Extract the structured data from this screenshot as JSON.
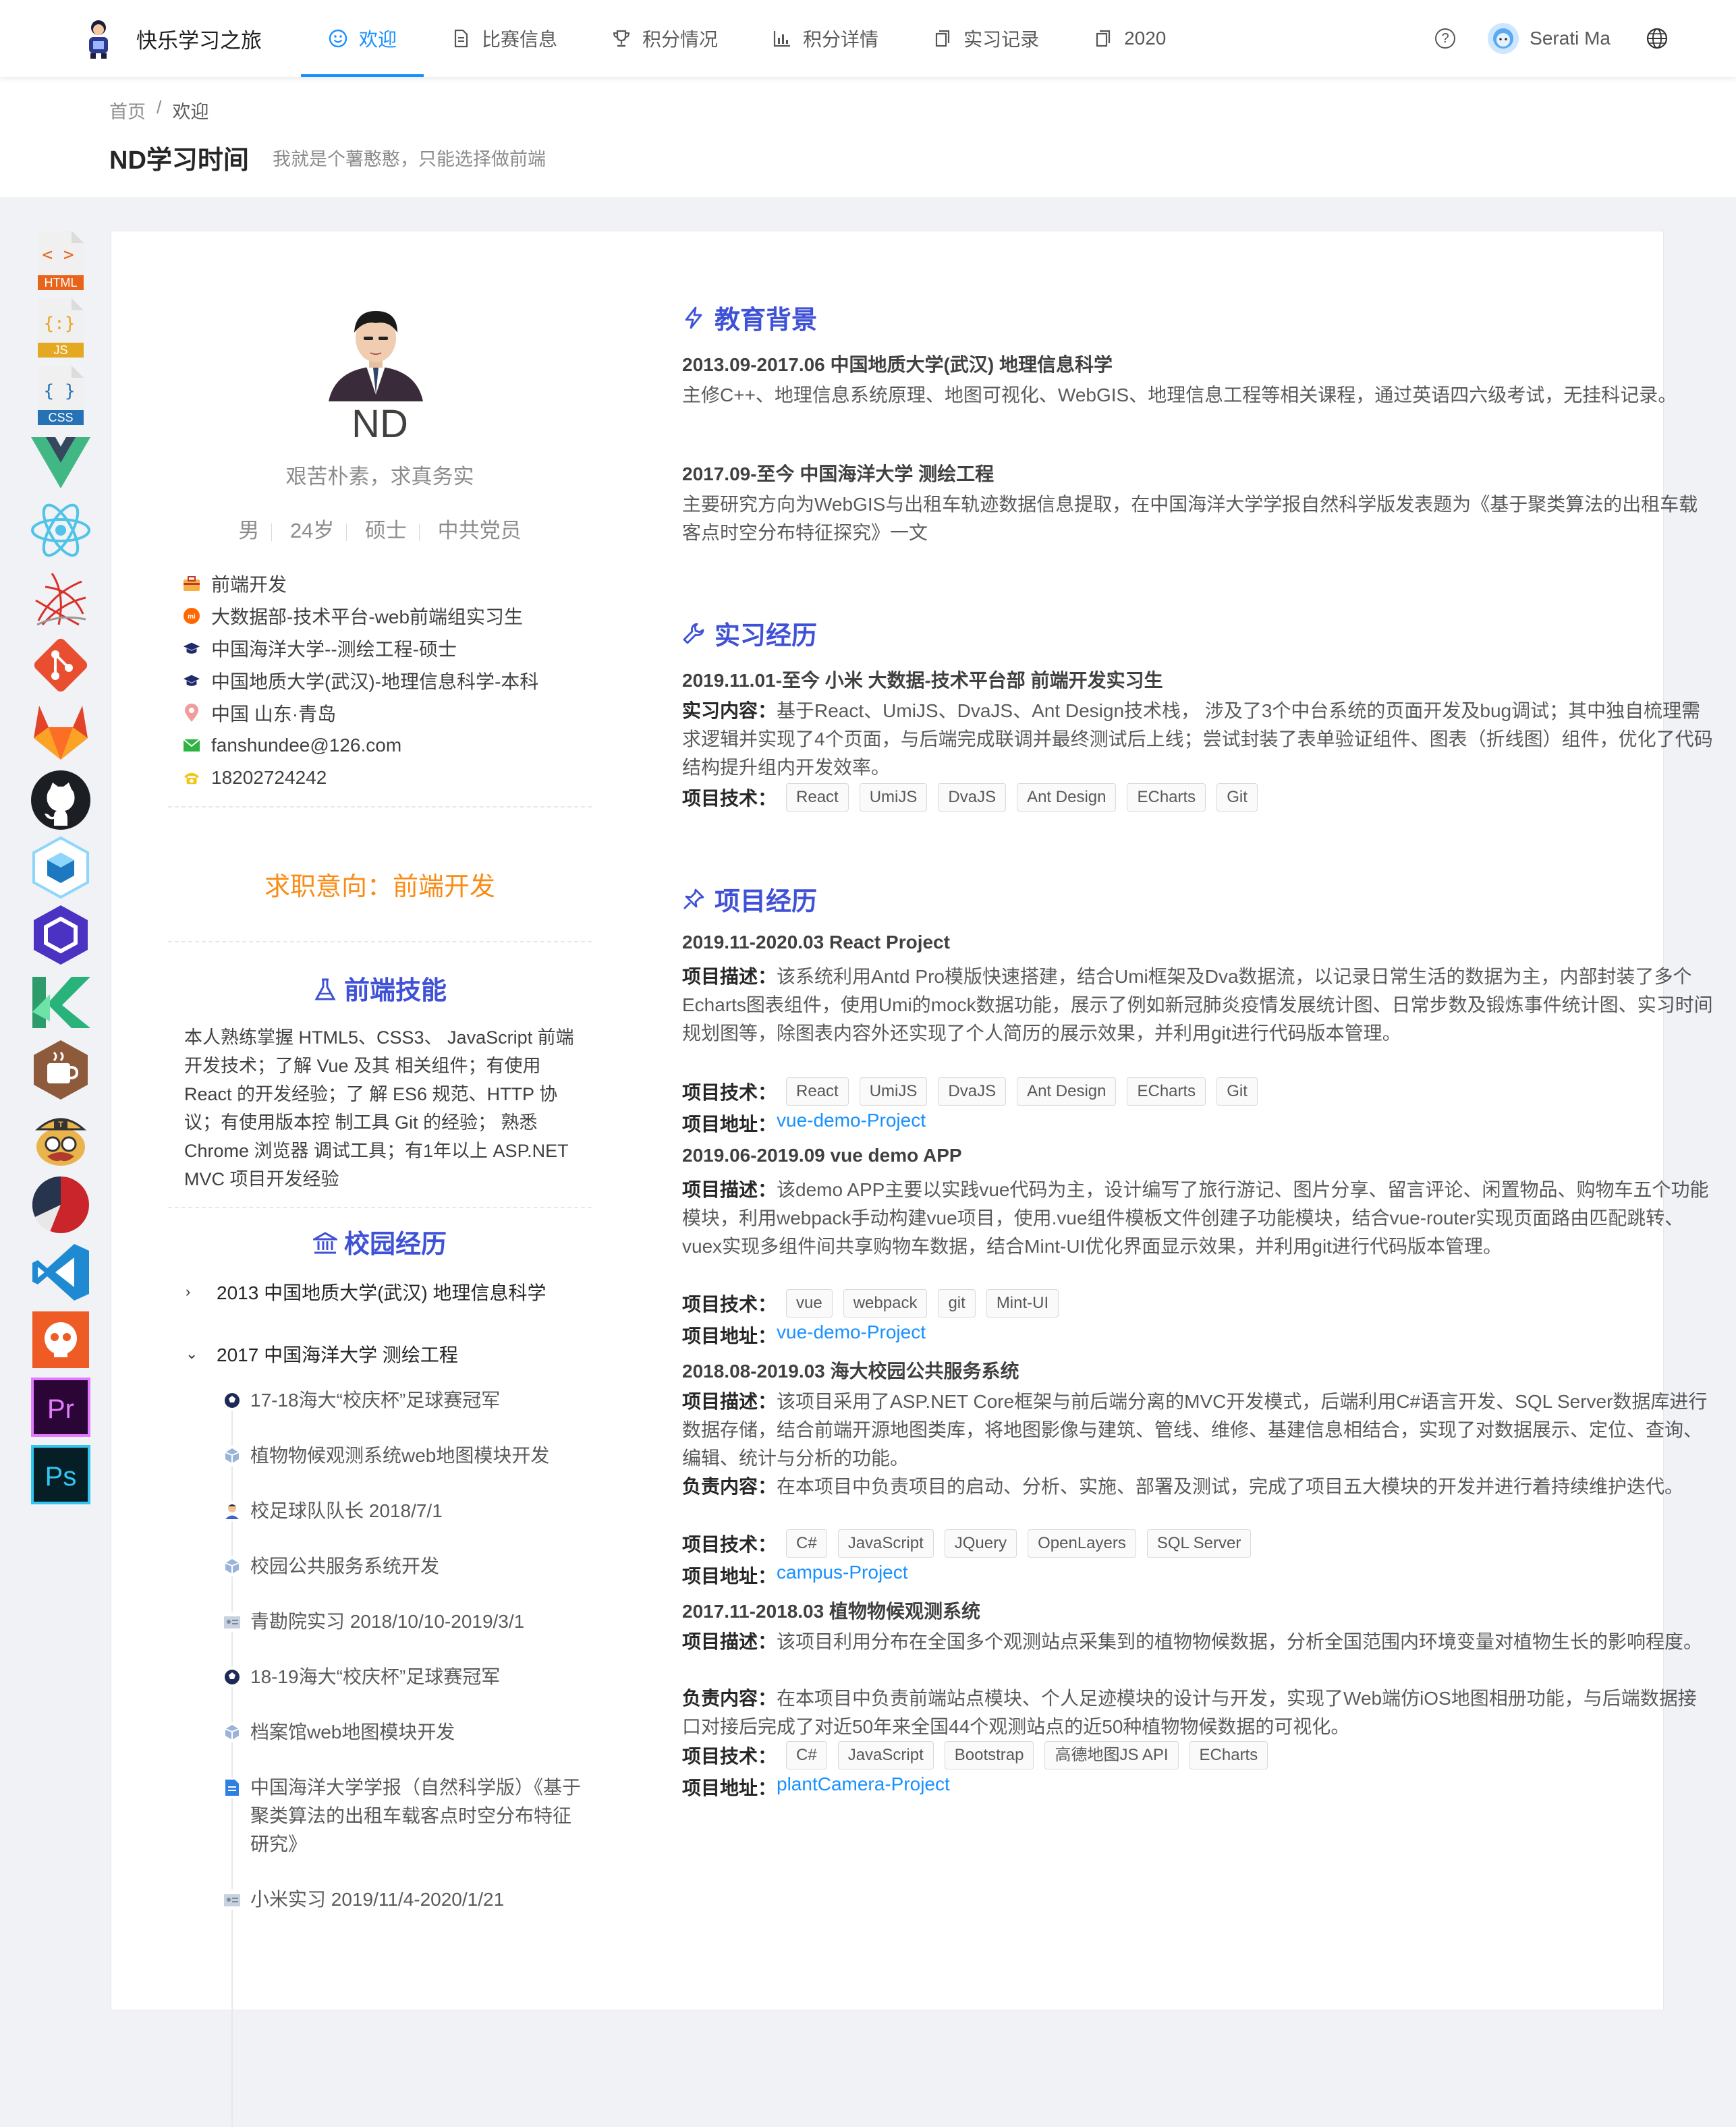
{
  "nav": {
    "brand": "快乐学习之旅",
    "items": [
      {
        "label": "欢迎",
        "icon": "smile-icon",
        "active": true
      },
      {
        "label": "比赛信息",
        "icon": "file-text-icon",
        "active": false
      },
      {
        "label": "积分情况",
        "icon": "trophy-icon",
        "active": false
      },
      {
        "label": "积分详情",
        "icon": "bar-chart-icon",
        "active": false
      },
      {
        "label": "实习记录",
        "icon": "copy-icon",
        "active": false
      },
      {
        "label": "2020",
        "icon": "copy-icon",
        "active": false
      }
    ],
    "user": "Serati Ma"
  },
  "header": {
    "breadcrumb": [
      "首页",
      "欢迎"
    ],
    "title": "ND学习时间",
    "subtitle": "我就是个薯憨憨，只能选择做前端"
  },
  "rail_icons": [
    "html-icon",
    "js-icon",
    "css-icon",
    "vue-icon",
    "react-icon",
    "sql-server-icon",
    "git-icon",
    "gitlab-icon",
    "github-icon",
    "webpack-icon",
    "eslint-icon",
    "kotlin-icon",
    "java-icon",
    "tomcat-icon",
    "pie-chart-icon",
    "vscode-icon",
    "postman-icon",
    "premiere-icon",
    "photoshop-icon"
  ],
  "profile": {
    "name": "ND",
    "motto": "艰苦朴素，求真务实",
    "tags": [
      "男",
      "24岁",
      "硕士",
      "中共党员"
    ],
    "info": [
      {
        "icon": "briefcase-icon",
        "text": "前端开发"
      },
      {
        "icon": "mi-icon",
        "text": "大数据部-技术平台-web前端组实习生"
      },
      {
        "icon": "graduation-cap-icon",
        "text": "中国海洋大学--测绘工程-硕士"
      },
      {
        "icon": "graduation-cap-icon",
        "text": "中国地质大学(武汉)-地理信息科学-本科"
      },
      {
        "icon": "location-pin-icon",
        "text": "中国 山东·青岛"
      },
      {
        "icon": "mail-icon",
        "text": "fanshundee@126.com"
      },
      {
        "icon": "phone-icon",
        "text": "18202724242"
      }
    ],
    "intent": "求职意向：前端开发",
    "skills_title": "前端技能",
    "skills_text": "本人熟练掌握 HTML5、CSS3、 JavaScript 前端开发技术；了解 Vue 及其 相关组件；有使用React 的开发经验；了 解 ES6 规范、HTTP 协议；有使用版本控 制工具 Git 的经验； 熟悉Chrome 浏览器 调试工具；有1年以上 ASP.NET MVC 项目开发经验",
    "campus_title": "校园经历",
    "campus_groups": [
      {
        "label": "2013 中国地质大学(武汉) 地理信息科学",
        "expanded": false
      },
      {
        "label": "2017 中国海洋大学 测绘工程",
        "expanded": true
      }
    ],
    "campus_items": [
      {
        "icon": "football-icon",
        "text": "17-18海大“校庆杯”足球赛冠军"
      },
      {
        "icon": "code-sandbox-icon",
        "text": "植物物候观测系统web地图模块开发"
      },
      {
        "icon": "captain-icon",
        "text": "校足球队队长 2018/7/1"
      },
      {
        "icon": "code-sandbox-icon",
        "text": "校园公共服务系统开发"
      },
      {
        "icon": "id-card-icon",
        "text": "青勘院实习 2018/10/10-2019/3/1"
      },
      {
        "icon": "football-icon",
        "text": "18-19海大“校庆杯”足球赛冠军"
      },
      {
        "icon": "code-sandbox-icon",
        "text": "档案馆web地图模块开发"
      },
      {
        "icon": "document-icon",
        "text": "中国海洋大学学报（自然科学版）《基于聚类算法的出租车载客点时空分布特征研究》"
      },
      {
        "icon": "id-card-icon",
        "text": "小米实习 2019/11/4-2020/1/21"
      }
    ]
  },
  "education": {
    "title": "教育背景",
    "entries": [
      {
        "heading": "2013.09-2017.06 中国地质大学(武汉) 地理信息科学",
        "text": "主修C++、地理信息系统原理、地图可视化、WebGIS、地理信息工程等相关课程，通过英语四六级考试，无挂科记录。"
      },
      {
        "heading": "2017.09-至今 中国海洋大学 测绘工程",
        "text": "主要研究方向为WebGIS与出租车轨迹数据信息提取，在中国海洋大学学报自然科学版发表题为《基于聚类算法的出租车载客点时空分布特征探究》一文"
      }
    ]
  },
  "internship": {
    "title": "实习经历",
    "heading": "2019.11.01-至今 小米 大数据-技术平台部 前端开发实习生",
    "content_label": "实习内容：",
    "content": "基于React、UmiJS、DvaJS、Ant Design技术栈， 涉及了3个中台系统的页面开发及bug调试；其中独自梳理需求逻辑并实现了4个页面，与后端完成联调并最终测试后上线；尝试封装了表单验证组件、图表（折线图）组件，优化了代码结构提升组内开发效率。",
    "tech_label": "项目技术：",
    "tags": [
      "React",
      "UmiJS",
      "DvaJS",
      "Ant Design",
      "ECharts",
      "Git"
    ]
  },
  "projects": {
    "title": "项目经历",
    "desc_label": "项目描述：",
    "duty_label": "负责内容：",
    "tech_label": "项目技术：",
    "link_label": "项目地址：",
    "p1": {
      "heading": "2019.11-2020.03 React Project",
      "desc": "该系统利用Antd Pro模版快速搭建，结合Umi框架及Dva数据流，以记录日常生活的数据为主，内部封装了多个Echarts图表组件，使用Umi的mock数据功能，展示了例如新冠肺炎疫情发展统计图、日常步数及锻炼事件统计图、实习时间规划图等，除图表内容外还实现了个人简历的展示效果，并利用git进行代码版本管理。",
      "tags": [
        "React",
        "UmiJS",
        "DvaJS",
        "Ant Design",
        "ECharts",
        "Git"
      ],
      "link": "vue-demo-Project"
    },
    "p2": {
      "heading": "2019.06-2019.09 vue demo APP",
      "desc": "该demo APP主要以实践vue代码为主，设计编写了旅行游记、图片分享、留言评论、闲置物品、购物车五个功能模块，利用webpack手动构建vue项目，使用.vue组件模板文件创建子功能模块，结合vue-router实现页面路由匹配跳转、vuex实现多组件间共享购物车数据，结合Mint-UI优化界面显示效果，并利用git进行代码版本管理。",
      "tags": [
        "vue",
        "webpack",
        "git",
        "Mint-UI"
      ],
      "link": "vue-demo-Project"
    },
    "p3": {
      "heading": "2018.08-2019.03 海大校园公共服务系统",
      "desc": "该项目采用了ASP.NET Core框架与前后端分离的MVC开发模式，后端利用C#语言开发、SQL Server数据库进行数据存储，结合前端开源地图类库，将地图影像与建筑、管线、维修、基建信息相结合，实现了对数据展示、定位、查询、编辑、统计与分析的功能。",
      "duty": "在本项目中负责项目的启动、分析、实施、部署及测试，完成了项目五大模块的开发并进行着持续维护迭代。",
      "tags": [
        "C#",
        "JavaScript",
        "JQuery",
        "OpenLayers",
        "SQL Server"
      ],
      "link": "campus-Project"
    },
    "p4": {
      "heading": "2017.11-2018.03 植物物候观测系统",
      "desc": "该项目利用分布在全国多个观测站点采集到的植物物候数据，分析全国范围内环境变量对植物生长的影响程度。",
      "duty": "在本项目中负责前端站点模块、个人足迹模块的设计与开发，实现了Web端仿iOS地图相册功能，与后端数据接口对接后完成了对近50年来全国44个观测站点的近50种植物物候数据的可视化。",
      "tags": [
        "C#",
        "JavaScript",
        "Bootstrap",
        "高德地图JS API",
        "ECharts"
      ],
      "link": "plantCamera-Project"
    }
  }
}
